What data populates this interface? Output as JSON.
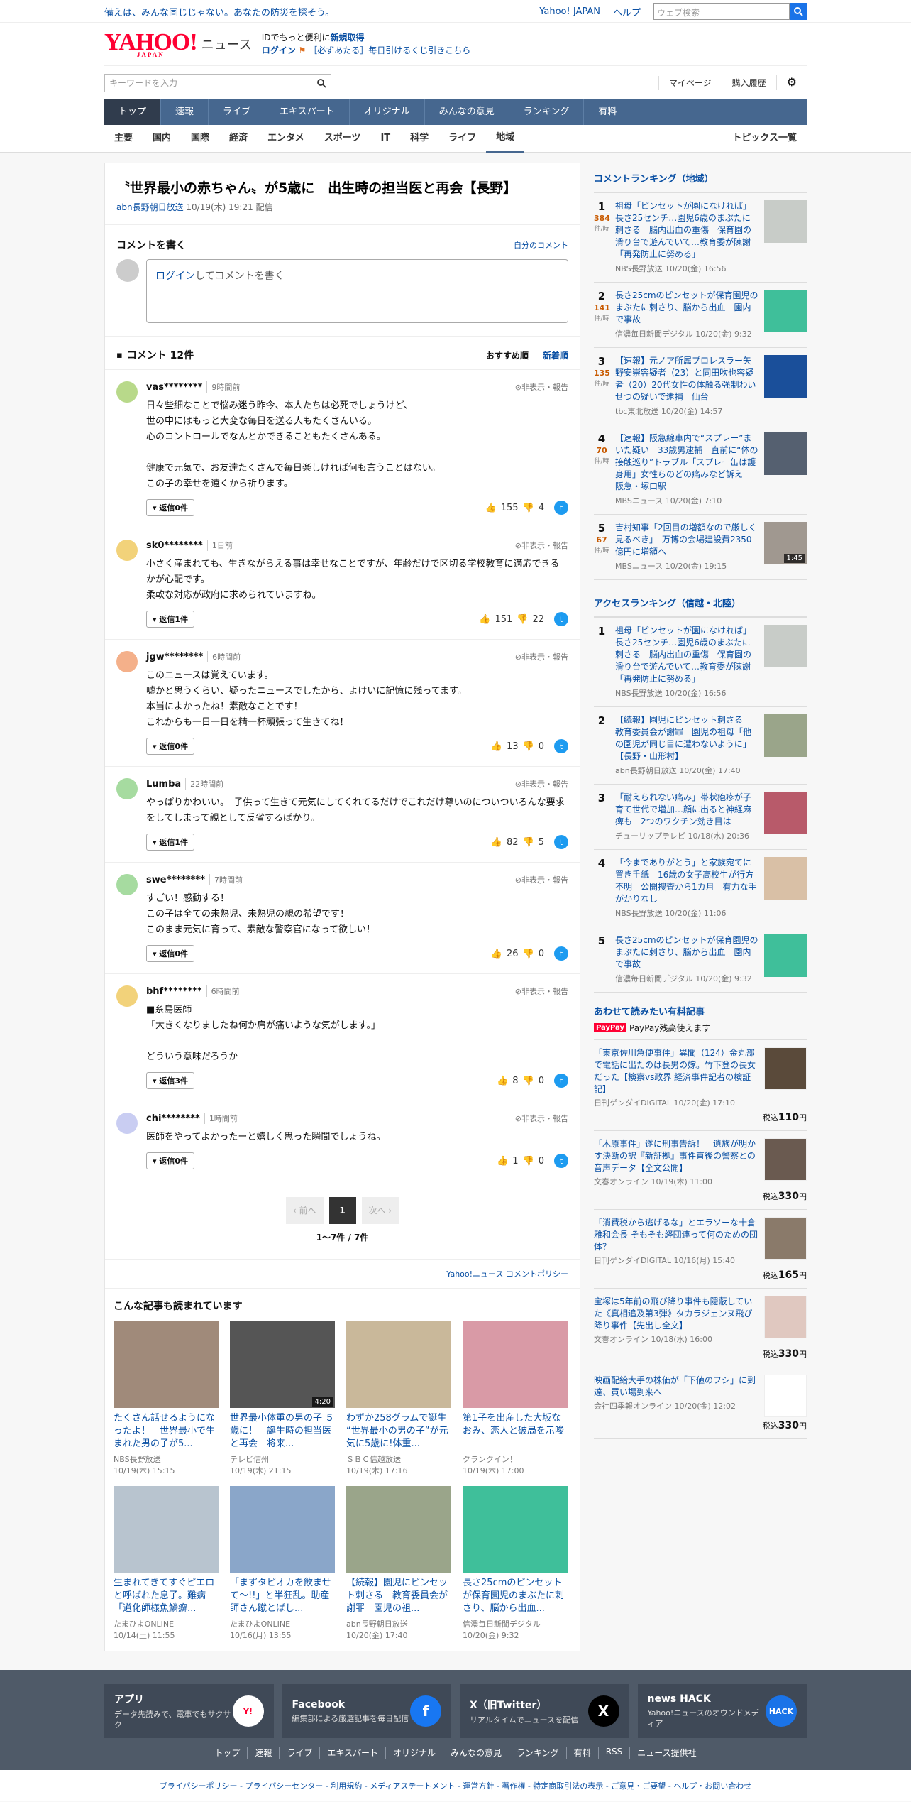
{
  "top": {
    "tagline": "備えは、みんな同じじゃない。あなたの防災を探そう。",
    "yj": "Yahoo! JAPAN",
    "help": "ヘルプ",
    "search_ph": "ウェブ検索"
  },
  "header": {
    "logo": "YAHOO!",
    "logo_sub": "JAPAN",
    "news": "ニュース",
    "id_text": "IDでもっと便利に",
    "signup": "新規取得",
    "login": "ログイン",
    "lottery": "［必ずあたる］毎日引けるくじ引きこちら",
    "kw_ph": "キーワードを入力",
    "mypage": "マイページ",
    "history": "購入履歴"
  },
  "nav": [
    "トップ",
    "速報",
    "ライブ",
    "エキスパート",
    "オリジナル",
    "みんなの意見",
    "ランキング",
    "有料"
  ],
  "subnav": [
    "主要",
    "国内",
    "国際",
    "経済",
    "エンタメ",
    "スポーツ",
    "IT",
    "科学",
    "ライフ",
    "地域"
  ],
  "subnav_all": "トピックス一覧",
  "article": {
    "title": "〝世界最小の赤ちゃん〟が5歳に　出生時の担当医と再会【長野】",
    "source": "abn長野朝日放送",
    "date": "10/19(木) 19:21",
    "delivered": "配信"
  },
  "cwrite": {
    "heading": "コメントを書く",
    "own": "自分のコメント",
    "login": "ログイン",
    "placeholder": "してコメントを書く"
  },
  "chead": {
    "count": "コメント 12件",
    "sort1": "おすすめ順",
    "sort2": "新着順"
  },
  "comments": [
    {
      "user": "vas********",
      "time": "9時間前",
      "body": "日々些細なことで悩み迷う昨今、本人たちは必死でしょうけど、\n世の中にはもっと大変な毎日を送る人もたくさんいる。\n心のコントロールでなんとかできることもたくさんある。\n\n健康で元気で、お友達たくさんで毎日楽しければ何も言うことはない。\nこの子の幸せを遠くから祈ります。",
      "replies": "返信0件",
      "up": "155",
      "down": "4",
      "color": "#b8d98a"
    },
    {
      "user": "sk0********",
      "time": "1日前",
      "body": "小さく産まれても、生きながらえる事は幸せなことですが、年齢だけで区切る学校教育に適応できるかが心配です。\n柔軟な対応が政府に求められていますね。",
      "replies": "返信1件",
      "up": "151",
      "down": "22",
      "color": "#f2d27a"
    },
    {
      "user": "jgw********",
      "time": "6時間前",
      "body": "このニュースは覚えています。\n嘘かと思うくらい、疑ったニュースでしたから、よけいに記憶に残ってます。\n本当によかったね！素敵なことです！\nこれからも一日一日を精一杯頑張って生きてね！",
      "replies": "返信0件",
      "up": "13",
      "down": "0",
      "color": "#f4b08a"
    },
    {
      "user": "Lumba",
      "time": "22時間前",
      "body": "やっぱりかわいい。　子供って生きて元気にしてくれてるだけでこれだけ尊いのについついろんな要求をしてしまって親として反省するばかり。",
      "replies": "返信1件",
      "up": "82",
      "down": "5",
      "color": "#a6dba0"
    },
    {
      "user": "swe********",
      "time": "7時間前",
      "body": "すごい！感動する！\nこの子は全ての未熟児、未熟児の親の希望です！\nこのまま元気に育って、素敵な警察官になって欲しい！",
      "replies": "返信0件",
      "up": "26",
      "down": "0",
      "color": "#a6dba0"
    },
    {
      "user": "bhf********",
      "time": "6時間前",
      "body": "■糸島医師\n「大きくなりましたね何か肩が痛いような気がします。」\n\nどういう意味だろうか",
      "replies": "返信3件",
      "up": "8",
      "down": "0",
      "color": "#f2d27a"
    },
    {
      "user": "chi********",
      "time": "1時間前",
      "body": "医師をやってよかったーと嬉しく思った瞬間でしょうね。",
      "replies": "返信0件",
      "up": "1",
      "down": "0",
      "color": "#c9cdf2"
    }
  ],
  "report": "非表示・報告",
  "pager": {
    "prev": "前へ",
    "page": "1",
    "next": "次へ",
    "count": "1〜7件 / 7件"
  },
  "policy": "Yahoo!ニュース コメントポリシー",
  "rec": {
    "heading": "こんな記事も読まれています",
    "items": [
      {
        "title": "たくさん話せるようになったよ！　世界最小で生まれた男の子が5...",
        "src": "NBS長野放送",
        "date": "10/19(木) 15:15",
        "color": "#a08a7a",
        "dur": ""
      },
      {
        "title": "世界最小体重の男の子 ５歳に！　誕生時の担当医と再会　将来...",
        "src": "テレビ信州",
        "date": "10/19(木) 21:15",
        "color": "#555",
        "dur": "4:20"
      },
      {
        "title": "わずか258グラムで誕生 “世界最小の男の子”が元気に5歳に!体重...",
        "src": "ＳＢＣ信越放送",
        "date": "10/19(木) 17:16",
        "color": "#c9b89a",
        "dur": ""
      },
      {
        "title": "第1子を出産した大坂なおみ、恋人と破局を示唆",
        "src": "クランクイン！",
        "date": "10/19(木) 17:00",
        "color": "#d99aa6",
        "dur": ""
      },
      {
        "title": "生まれてきてすぐピエロと呼ばれた息子。難病「道化師様魚鱗癬...",
        "src": "たまひよONLINE",
        "date": "10/14(土) 11:55",
        "color": "#b8c4cf",
        "dur": ""
      },
      {
        "title": "「まずタピオカを飲ませて〜!!」と半狂乱。助産師さん蹴とばし...",
        "src": "たまひよONLINE",
        "date": "10/16(月) 13:55",
        "color": "#8aa6c9",
        "dur": ""
      },
      {
        "title": "【続報】園児にピンセット刺さる　教育委員会が謝罪　園児の祖...",
        "src": "abn長野朝日放送",
        "date": "10/20(金) 17:40",
        "color": "#9aa58a",
        "dur": ""
      },
      {
        "title": "長さ25cmのピンセットが保育園児のまぶたに刺さり、脳から出血...",
        "src": "信濃毎日新聞デジタル",
        "date": "10/20(金) 9:32",
        "color": "#3fbf9a",
        "dur": ""
      }
    ]
  },
  "crank": {
    "heading": "コメントランキング（地域）",
    "unit": "件/時",
    "items": [
      {
        "rank": "1",
        "num": "384",
        "title": "祖母「ピンセットが園になければ」長さ25センチ…園児6歳のまぶたに刺さる　脳内出血の重傷　保育園の滑り台で遊んでいて…教育委が陳謝「再発防止に努める」",
        "src": "NBS長野放送 10/20(金) 16:56",
        "color": "#c8ccc8",
        "dur": ""
      },
      {
        "rank": "2",
        "num": "141",
        "title": "長さ25cmのピンセットが保育園児のまぶたに刺さり、脳から出血　園内で事故",
        "src": "信濃毎日新聞デジタル 10/20(金) 9:32",
        "color": "#3fbf9a",
        "dur": ""
      },
      {
        "rank": "3",
        "num": "135",
        "title": "【速報】元ノア所属プロレスラー矢野安崇容疑者（23）と同田吹也容疑者（20）20代女性の体触る強制わいせつの疑いで逮捕　仙台",
        "src": "tbc東北放送 10/20(金) 14:57",
        "color": "#1a4f9a",
        "dur": ""
      },
      {
        "rank": "4",
        "num": "70",
        "title": "【速報】阪急線車内で“スプレー”まいた疑い　33歳男逮捕　直前に“体の接触巡り”トラブル「スプレー缶は護身用」女性らのどの痛みなど訴え　阪急・塚口駅",
        "src": "MBSニュース 10/20(金) 7:10",
        "color": "#556070",
        "dur": ""
      },
      {
        "rank": "5",
        "num": "67",
        "title": "吉村知事「2回目の増額なので厳しく見るべき」　万博の会場建設費2350億円に増額へ",
        "src": "MBSニュース 10/20(金) 19:15",
        "color": "#a09890",
        "dur": "1:45"
      }
    ]
  },
  "arank": {
    "heading": "アクセスランキング（信越・北陸）",
    "items": [
      {
        "rank": "1",
        "title": "祖母「ピンセットが園になければ」長さ25センチ…園児6歳のまぶたに刺さる　脳内出血の重傷　保育園の滑り台で遊んでいて…教育委が陳謝「再発防止に努める」",
        "src": "NBS長野放送 10/20(金) 16:56",
        "color": "#c8ccc8"
      },
      {
        "rank": "2",
        "title": "【続報】園児にピンセット刺さる　教育委員会が謝罪　園児の祖母「他の園児が同じ目に遭わないように」【長野・山形村】",
        "src": "abn長野朝日放送 10/20(金) 17:40",
        "color": "#9aa58a"
      },
      {
        "rank": "3",
        "title": "「耐えられない痛み」帯状疱疹が子育て世代で増加…顔に出ると神経麻痺も　2つのワクチン効き目は",
        "src": "チューリップテレビ 10/18(水) 20:36",
        "color": "#b85a6a"
      },
      {
        "rank": "4",
        "title": "「今までありがとう」と家族宛てに置き手紙　16歳の女子高校生が行方不明　公開捜査から1カ月　有力な手がかりなし",
        "src": "NBS長野放送 10/20(金) 11:06",
        "color": "#d9c0a6"
      },
      {
        "rank": "5",
        "title": "長さ25cmのピンセットが保育園児のまぶたに刺さり、脳から出血　園内で事故",
        "src": "信濃毎日新聞デジタル 10/20(金) 9:32",
        "color": "#3fbf9a"
      }
    ]
  },
  "paid": {
    "heading": "あわせて読みたい有料記事",
    "paypay": "PayPay",
    "paypay_text": "PayPay残高使えます",
    "yen": "円",
    "tax": "税込",
    "items": [
      {
        "title": "「東京佐川急便事件」異聞（124）金丸部で電話に出たのは長男の嫁。竹下登の長女だった【検察vs政界 経済事件記者の検証記】",
        "src": "日刊ゲンダイDIGITAL 10/20(金) 17:10",
        "price": "110",
        "color": "#5a4a3a"
      },
      {
        "title": "「木原事件」遂に刑事告訴！　遺族が明かす決断の訳『新証拠』事件直後の警察との音声データ【全文公開】",
        "src": "文春オンライン 10/19(木) 11:00",
        "price": "330",
        "color": "#6a5a50"
      },
      {
        "title": "「消費税から逃げるな」とエラソーな十倉雅和会長 そもそも経団連って何のための団体？",
        "src": "日刊ゲンダイDIGITAL 10/16(月) 15:40",
        "price": "165",
        "color": "#8a7a6a"
      },
      {
        "title": "宝塚は5年前の飛び降り事件も隠蔽していた《真相追及第3弾》タカラジェンヌ飛び降り事件【先出し全文】",
        "src": "文春オンライン 10/18(水) 16:00",
        "price": "330",
        "color": "#e0c8c0"
      },
      {
        "title": "映画配給大手の株価が「下値のフシ」に到達、買い場到来へ",
        "src": "会社四季報オンライン 10/20(金) 12:02",
        "price": "330",
        "color": "#fff"
      }
    ]
  },
  "footer": {
    "boxes": [
      {
        "title": "アプリ",
        "text": "データ先読みで、電車でもサクサク",
        "icon": "Y!"
      },
      {
        "title": "Facebook",
        "text": "編集部による厳選記事を毎日配信",
        "icon": "f"
      },
      {
        "title": "X（旧Twitter）",
        "text": "リアルタイムでニュースを配信",
        "icon": "X"
      },
      {
        "title": "news HACK",
        "text": "Yahoo!ニュースのオウンドメディア",
        "icon": "HACK"
      }
    ],
    "nav": [
      "トップ",
      "速報",
      "ライブ",
      "エキスパート",
      "オリジナル",
      "みんなの意見",
      "ランキング",
      "有料",
      "RSS",
      "ニュース提供社"
    ],
    "legal": "プライバシーポリシー - プライバシーセンター - 利用規約 - メディアステートメント - 運営方針 - 著作権 - 特定商取引法の表示 - ご意見・ご要望 - ヘルプ・お問い合わせ"
  },
  "colors": {
    "nav": "#46678f",
    "link": "#094fa3",
    "brand": "#ff0033"
  }
}
